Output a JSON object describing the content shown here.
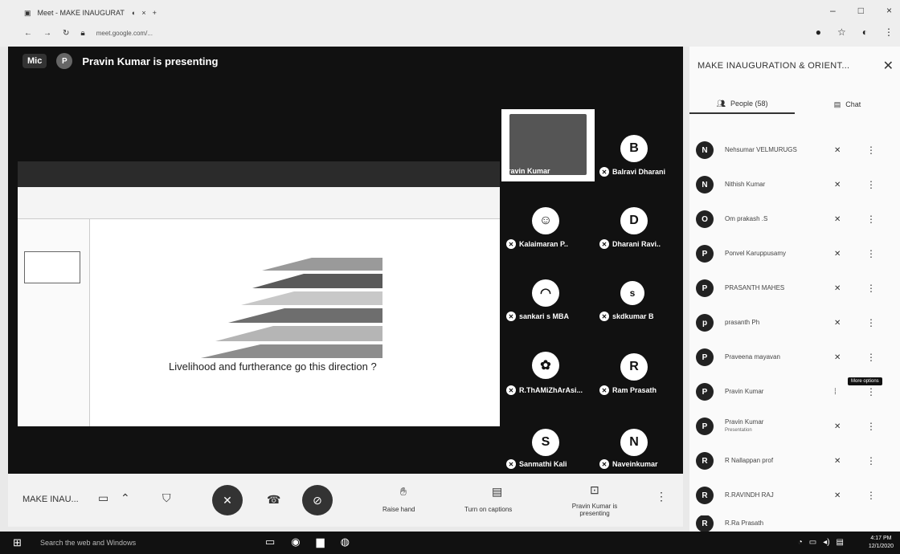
{
  "browser": {
    "tab_title": "Meet - MAKE INAUGURAT",
    "url": "meet.google.com/...",
    "controls": [
      "–",
      "□",
      "×"
    ]
  },
  "stage": {
    "badge": "Mic",
    "presenter_initial": "P",
    "presenting_text": "Pravin Kumar is presenting",
    "slide_title": "Livelihood and furtherance go this direction ?"
  },
  "tiles": [
    {
      "name": "Pravin Kumar",
      "initial": ""
    },
    {
      "name": "Balravi Dharani",
      "initial": "B"
    },
    {
      "name": "Kalaimaran P..",
      "initial": ""
    },
    {
      "name": "Dharani Ravi..",
      "initial": "D"
    },
    {
      "name": "sankari s MBA",
      "initial": ""
    },
    {
      "name": "skdkumar B",
      "initial": "s"
    },
    {
      "name": "R.ThAMiZhArAsi...",
      "initial": ""
    },
    {
      "name": "Ram Prasath",
      "initial": "R"
    },
    {
      "name": "Sanmathi Kali",
      "initial": "S"
    },
    {
      "name": "Naveinkumar",
      "initial": "N"
    }
  ],
  "controls": {
    "meeting_name": "MAKE INAU...",
    "raise_hand": "Raise hand",
    "captions": "Turn on captions",
    "presenting": "Pravin Kumar is presenting"
  },
  "panel": {
    "title": "MAKE INAUGURATION & ORIENT...",
    "tab_people": "People (58)",
    "tab_chat": "Chat",
    "tooltip": "More options",
    "people": [
      {
        "name": "Nehsumar VELMURUGS",
        "sub": "",
        "initial": "N"
      },
      {
        "name": "Nithish Kumar",
        "sub": "",
        "initial": "N"
      },
      {
        "name": "Om prakash .S",
        "sub": "",
        "initial": "O"
      },
      {
        "name": "Ponvel Karuppusamy",
        "sub": "",
        "initial": "P"
      },
      {
        "name": "PRASANTH MAHES",
        "sub": "",
        "initial": "P"
      },
      {
        "name": "prasanth Ph",
        "sub": "",
        "initial": "p"
      },
      {
        "name": "Praveena mayavan",
        "sub": "",
        "initial": "P"
      },
      {
        "name": "Pravin Kumar",
        "sub": "",
        "initial": "P"
      },
      {
        "name": "Pravin Kumar",
        "sub": "Presentation",
        "initial": "P"
      },
      {
        "name": "R Nallappan prof",
        "sub": "",
        "initial": "R"
      },
      {
        "name": "R.RAVINDH RAJ",
        "sub": "",
        "initial": "R"
      },
      {
        "name": "R.Ra Prasath",
        "sub": "",
        "initial": "R"
      }
    ]
  },
  "taskbar": {
    "search": "Search the web and Windows",
    "time": "4:17 PM",
    "date": "12/1/2020"
  }
}
